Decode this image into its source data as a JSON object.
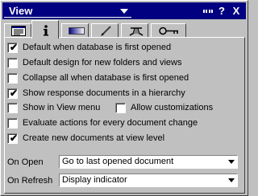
{
  "titlebar": {
    "title": "View",
    "menu_icon": "menu-dots-icon",
    "help_label": "?",
    "close_label": "X"
  },
  "tabs": [
    {
      "icon": "list-icon",
      "active": false
    },
    {
      "icon": "info-icon",
      "active": true
    },
    {
      "icon": "gradient-bar-icon",
      "active": false
    },
    {
      "icon": "brush-icon",
      "active": false
    },
    {
      "icon": "hat-icon",
      "active": false
    },
    {
      "icon": "key-icon",
      "active": false
    }
  ],
  "options": {
    "default_when_opened": {
      "label": "Default when database is first opened",
      "checked": true
    },
    "default_design": {
      "label": "Default design for new folders and views",
      "checked": false
    },
    "collapse_all": {
      "label": "Collapse all when database is first opened",
      "checked": false
    },
    "show_response_docs": {
      "label": "Show response documents in a hierarchy",
      "checked": true
    },
    "show_in_view_menu": {
      "label": "Show in View menu",
      "checked": false
    },
    "allow_customizations": {
      "label": "Allow customizations",
      "checked": false
    },
    "evaluate_actions": {
      "label": "Evaluate actions for every document change",
      "checked": false
    },
    "create_new_docs": {
      "label": "Create new documents at view level",
      "checked": true
    }
  },
  "on_open": {
    "label": "On Open",
    "value": "Go to last opened document"
  },
  "on_refresh": {
    "label": "On Refresh",
    "value": "Display indicator"
  },
  "check_glyph": "✔"
}
